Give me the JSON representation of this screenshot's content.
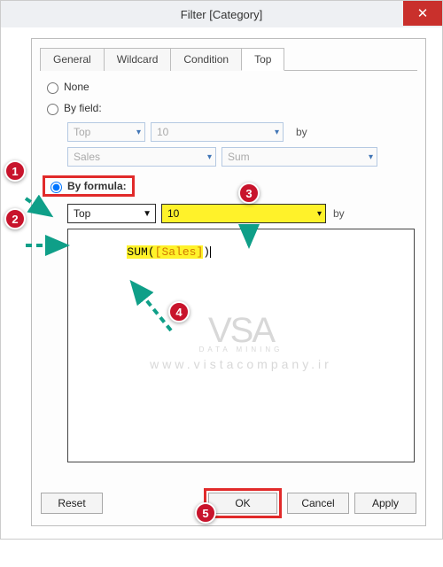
{
  "window": {
    "title": "Filter [Category]"
  },
  "tabs": {
    "general": "General",
    "wildcard": "Wildcard",
    "condition": "Condition",
    "top": "Top"
  },
  "radios": {
    "none": "None",
    "byfield": "By field:",
    "byformula": "By formula:"
  },
  "byfield": {
    "dir": "Top",
    "n": "10",
    "by": "by",
    "field": "Sales",
    "agg": "Sum"
  },
  "byformula": {
    "dir": "Top",
    "n": "10",
    "by": "by",
    "fn": "SUM",
    "open": "(",
    "lbr": "[",
    "field": "Sales",
    "rbr": "]",
    "close": ")"
  },
  "buttons": {
    "reset": "Reset",
    "ok": "OK",
    "cancel": "Cancel",
    "apply": "Apply"
  },
  "callouts": {
    "c1": "1",
    "c2": "2",
    "c3": "3",
    "c4": "4",
    "c5": "5"
  },
  "watermark": {
    "logo": "VSA",
    "tag": "DATA MINING",
    "url": "www.vistacompany.ir"
  }
}
